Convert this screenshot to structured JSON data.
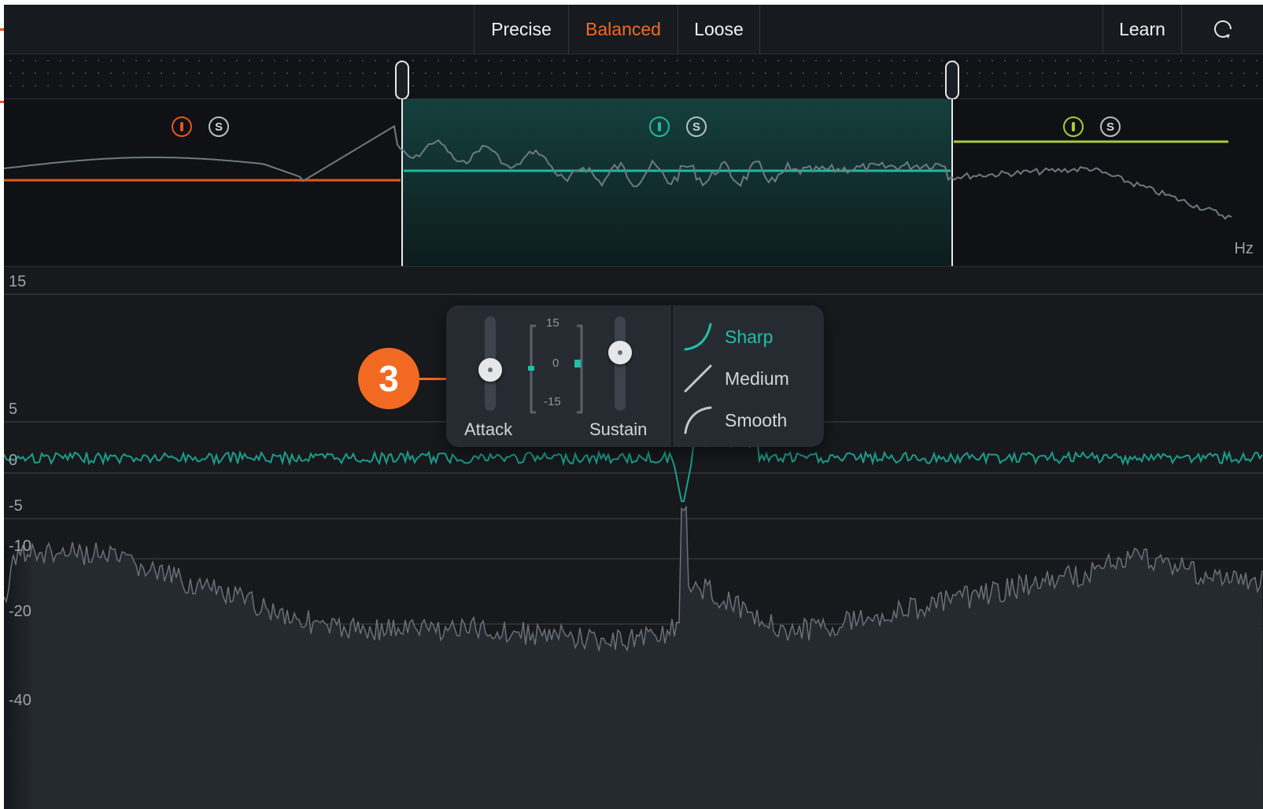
{
  "toolbar": {
    "modes": [
      {
        "label": "Precise",
        "active": false
      },
      {
        "label": "Balanced",
        "active": true
      },
      {
        "label": "Loose",
        "active": false
      }
    ],
    "learn_label": "Learn",
    "reset_icon": "refresh-icon"
  },
  "bands": [
    {
      "color": "#e8561b",
      "solo_label": "S"
    },
    {
      "color": "#1fb8a0",
      "solo_label": "S"
    },
    {
      "color": "#a6cc3a",
      "solo_label": "S"
    }
  ],
  "spectrum": {
    "unit_label": "Hz"
  },
  "meter": {
    "db_labels": [
      "15",
      "5",
      "0",
      "-5",
      "-10",
      "-20",
      "-40"
    ],
    "trace_color": "#1a9e8a"
  },
  "popup": {
    "attack_label": "Attack",
    "sustain_label": "Sustain",
    "scale": {
      "top": "15",
      "mid": "0",
      "bottom": "-15"
    },
    "curves": [
      {
        "label": "Sharp",
        "icon": "sharp-curve-icon",
        "selected": true
      },
      {
        "label": "Medium",
        "icon": "medium-curve-icon",
        "selected": false
      },
      {
        "label": "Smooth",
        "icon": "smooth-curve-icon",
        "selected": false
      }
    ]
  },
  "callout": {
    "number": "3"
  }
}
